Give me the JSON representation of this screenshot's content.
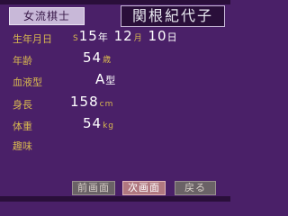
{
  "header": {
    "title": "女流棋士",
    "name": "関根紀代子"
  },
  "profile": {
    "birthday_label": "生年月日",
    "birthday": {
      "era": "S",
      "year": "15",
      "year_unit": "年",
      "month": "12",
      "month_unit": "月",
      "day": "10",
      "day_unit": "日"
    },
    "age_label": "年齢",
    "age": "54",
    "age_unit": "歳",
    "blood_label": "血液型",
    "blood": "A",
    "blood_unit": "型",
    "height_label": "身長",
    "height": "158",
    "height_unit": "cm",
    "weight_label": "体重",
    "weight": "54",
    "weight_unit": "kg",
    "hobby_label": "趣味",
    "hobby": ""
  },
  "footer": {
    "prev_label": "前画面",
    "next_label": "次画面",
    "back_label": "戻る"
  },
  "colors": {
    "background": "#4a2068",
    "label": "#d8b850",
    "value": "#ffffff",
    "active_button": "#b07880"
  }
}
